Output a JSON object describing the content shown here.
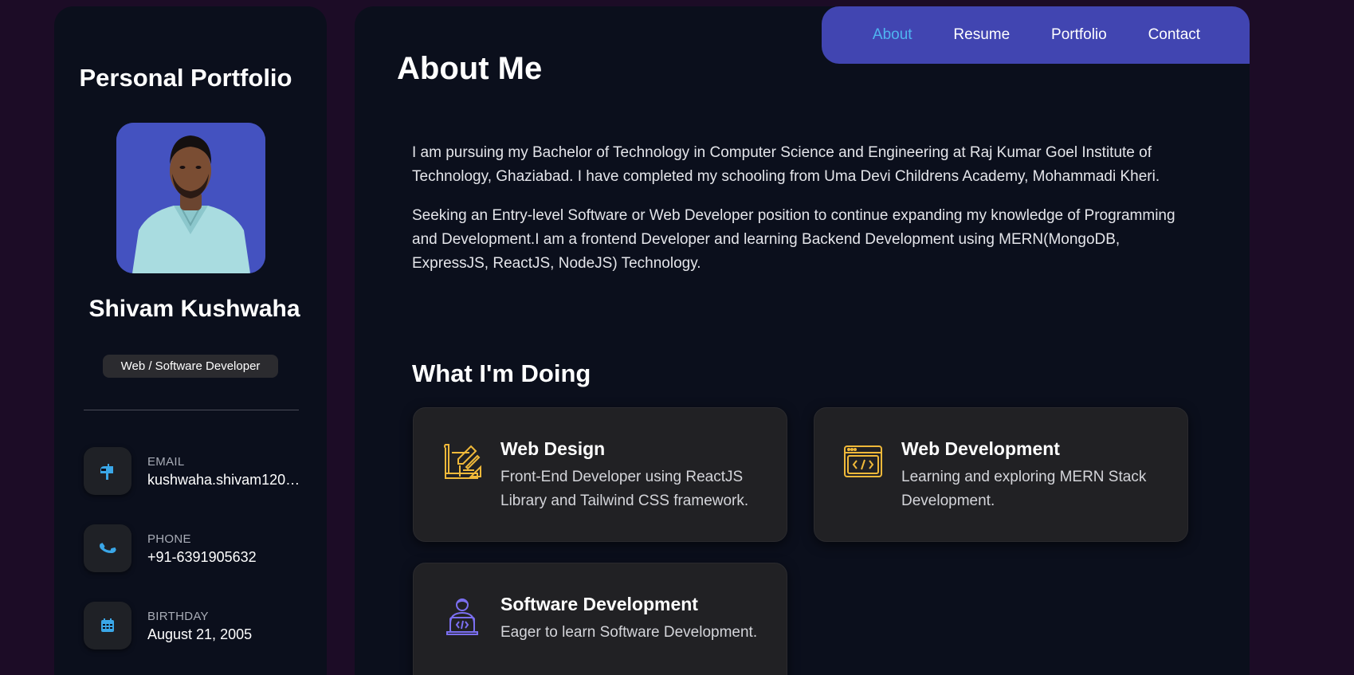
{
  "sidebar": {
    "title": "Personal Portfolio",
    "name": "Shivam Kushwaha",
    "role": "Web / Software Developer",
    "contacts": [
      {
        "label": "EMAIL",
        "value": "kushwaha.shivam120…",
        "icon": "mailbox-icon"
      },
      {
        "label": "PHONE",
        "value": "+91-6391905632",
        "icon": "phone-icon"
      },
      {
        "label": "BIRTHDAY",
        "value": "August 21, 2005",
        "icon": "calendar-icon"
      }
    ]
  },
  "nav": {
    "items": [
      {
        "label": "About",
        "active": true
      },
      {
        "label": "Resume",
        "active": false
      },
      {
        "label": "Portfolio",
        "active": false
      },
      {
        "label": "Contact",
        "active": false
      }
    ]
  },
  "about": {
    "title": "About Me",
    "paragraphs": [
      "I am pursuing my Bachelor of Technology in Computer Science and Engineering at Raj Kumar Goel Institute of Technology, Ghaziabad. I have completed my schooling from Uma Devi Childrens Academy, Mohammadi Kheri.",
      "Seeking an Entry-level Software or Web Developer position to continue expanding my knowledge of Programming and Development.I am a frontend Developer and learning Backend Development using MERN(MongoDB, ExpressJS, ReactJS, NodeJS) Technology."
    ]
  },
  "services": {
    "title": "What I'm Doing",
    "items": [
      {
        "title": "Web Design",
        "text": "Front-End Developer using ReactJS Library and Tailwind CSS framework.",
        "icon": "design-pencil-icon"
      },
      {
        "title": "Web Development",
        "text": "Learning and exploring MERN Stack Development.",
        "icon": "code-window-icon"
      },
      {
        "title": "Software Development",
        "text": "Eager to learn Software Development.",
        "icon": "developer-laptop-icon"
      }
    ]
  },
  "colors": {
    "background": "#1c0c26",
    "panel": "#0b0f1c",
    "nav": "#4145b1",
    "nav_active": "#4fb4f0",
    "card": "#212124",
    "icon_gold": "#f0b93a",
    "icon_blue": "#3aa7e8",
    "icon_purple": "#7b6ff0"
  }
}
